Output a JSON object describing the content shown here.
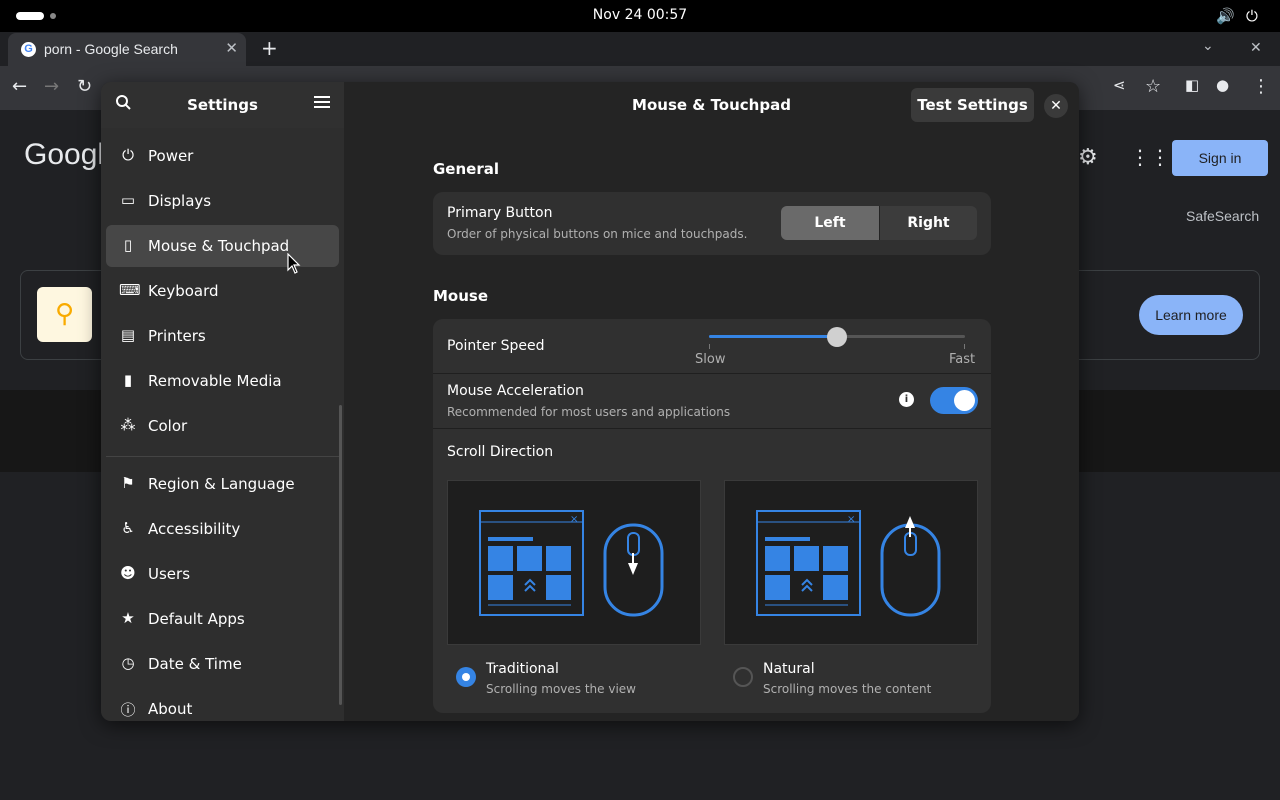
{
  "topbar": {
    "clock": "Nov 24  00:57",
    "volume_icon": "volume-icon",
    "power_icon": "power-icon"
  },
  "browser": {
    "tab_title": "porn - Google Search",
    "new_tab": "+",
    "close_tab": "✕",
    "logo_text": "Googl",
    "sign_in": "Sign in",
    "safesearch": "SafeSearch",
    "learn_more": "Learn more"
  },
  "sidebar": {
    "title": "Settings",
    "items": [
      {
        "label": "Power",
        "icon": "power-icon"
      },
      {
        "label": "Displays",
        "icon": "display-icon"
      },
      {
        "label": "Mouse & Touchpad",
        "icon": "mouse-icon",
        "active": true
      },
      {
        "label": "Keyboard",
        "icon": "keyboard-icon"
      },
      {
        "label": "Printers",
        "icon": "printer-icon"
      },
      {
        "label": "Removable Media",
        "icon": "usb-icon"
      },
      {
        "label": "Color",
        "icon": "color-icon"
      },
      {
        "label": "Region & Language",
        "icon": "flag-icon"
      },
      {
        "label": "Accessibility",
        "icon": "accessibility-icon"
      },
      {
        "label": "Users",
        "icon": "users-icon"
      },
      {
        "label": "Default Apps",
        "icon": "star-icon"
      },
      {
        "label": "Date & Time",
        "icon": "clock-icon"
      },
      {
        "label": "About",
        "icon": "info-icon"
      }
    ]
  },
  "content": {
    "title": "Mouse & Touchpad",
    "test_settings": "Test Settings",
    "general": {
      "heading": "General",
      "primary_button": "Primary Button",
      "primary_button_sub": "Order of physical buttons on mice and touchpads.",
      "left": "Left",
      "right": "Right"
    },
    "mouse": {
      "heading": "Mouse",
      "pointer_speed": "Pointer Speed",
      "pointer_speed_value": 0.5,
      "slow": "Slow",
      "fast": "Fast",
      "acceleration": "Mouse Acceleration",
      "acceleration_sub": "Recommended for most users and applications",
      "acceleration_on": true,
      "scroll_direction": "Scroll Direction",
      "traditional": "Traditional",
      "traditional_sub": "Scrolling moves the view",
      "natural": "Natural",
      "natural_sub": "Scrolling moves the content"
    }
  },
  "colors": {
    "accent": "#3584e4",
    "window_bg": "#242424",
    "sidebar_bg": "#2e2e2e"
  }
}
